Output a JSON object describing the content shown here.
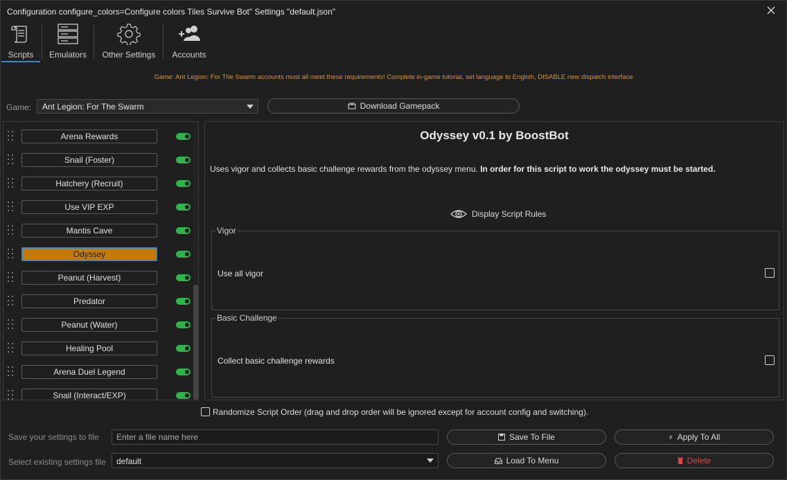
{
  "window": {
    "title": "Configuration configure_colors=Configure colors Tiles Survive Bot\" Settings \"default.json\""
  },
  "toolbar": {
    "tabs": [
      {
        "label": "Scripts",
        "icon": "scroll-icon",
        "active": true
      },
      {
        "label": "Emulators",
        "icon": "server-icon",
        "active": false
      },
      {
        "label": "Other Settings",
        "icon": "gear-icon",
        "active": false
      },
      {
        "label": "Accounts",
        "icon": "add-users-icon",
        "active": false
      }
    ]
  },
  "notice": "Game: Ant Legion: For The Swarm accounts must all meet these requirements! Complete in-game tutorial, set language to English, DISABLE new dispatch interface",
  "game": {
    "label": "Game:",
    "selected": "Ant Legion: For The Swarm",
    "download_label": "Download Gamepack"
  },
  "scripts": [
    {
      "name": "Arena Rewards",
      "enabled": true
    },
    {
      "name": "Snail (Foster)",
      "enabled": true
    },
    {
      "name": "Hatchery (Recruit)",
      "enabled": true
    },
    {
      "name": "Use VIP EXP",
      "enabled": true
    },
    {
      "name": "Mantis Cave",
      "enabled": true
    },
    {
      "name": "Odyssey",
      "enabled": true,
      "selected": true
    },
    {
      "name": "Peanut (Harvest)",
      "enabled": true
    },
    {
      "name": "Predator",
      "enabled": true
    },
    {
      "name": "Peanut (Water)",
      "enabled": true
    },
    {
      "name": "Healing Pool",
      "enabled": true
    },
    {
      "name": "Arena Duel Legend",
      "enabled": true
    },
    {
      "name": "Snail (Interact/EXP)",
      "enabled": true
    }
  ],
  "detail": {
    "title": "Odyssey v0.1 by BoostBot",
    "description": "Uses vigor and collects basic challenge rewards from the odyssey menu.",
    "description_bold": "In order for this script to work the odyssey must be started.",
    "rules_label": "Display Script Rules",
    "groups": [
      {
        "label": "Vigor",
        "option": "Use all vigor",
        "checked": false
      },
      {
        "label": "Basic Challenge",
        "option": "Collect basic challenge rewards",
        "checked": false
      }
    ]
  },
  "randomize": {
    "label": "Randomize Script Order (drag and drop order will be ignored except for account config and switching).",
    "checked": false
  },
  "footer": {
    "save_label": "Save your settings to file",
    "save_placeholder": "Enter a file name here",
    "select_label": "Select existing settings file",
    "select_value": "default",
    "save_button": "Save To File",
    "apply_button": "Apply To All",
    "load_button": "Load To Menu",
    "delete_button": "Delete"
  },
  "colors": {
    "accent": "#c57a08",
    "toggle_on": "#2fb34a",
    "notice": "#d49a24",
    "delete": "#e0464a",
    "tab_underline": "#3f86c8"
  }
}
